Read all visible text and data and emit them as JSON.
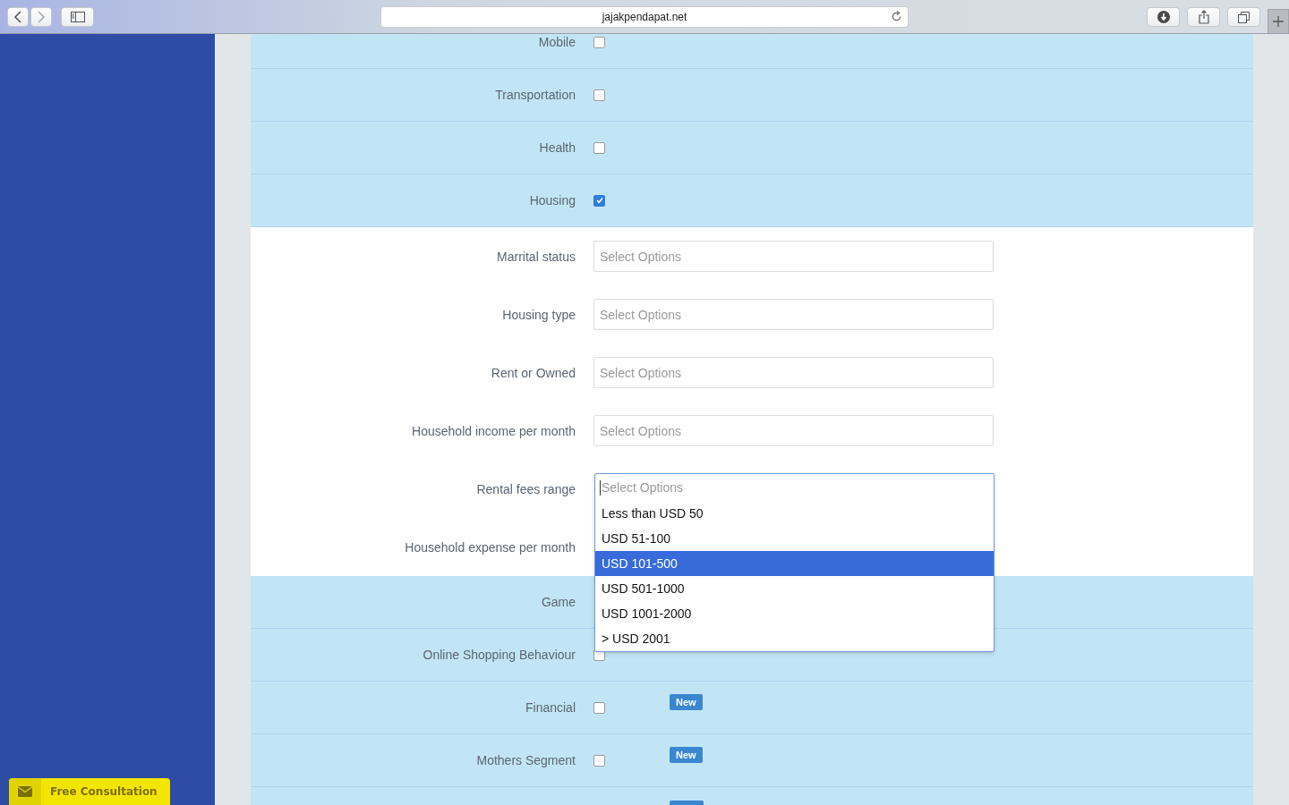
{
  "browser": {
    "url": "jajakpendapat.net"
  },
  "sections": [
    {
      "kind": "checks",
      "rows": [
        {
          "label": "Mobile",
          "checked": false
        },
        {
          "label": "Transportation",
          "checked": false
        },
        {
          "label": "Health",
          "checked": false
        },
        {
          "label": "Housing",
          "checked": true
        }
      ]
    },
    {
      "kind": "selects",
      "rows": [
        {
          "label": "Marrital status",
          "placeholder": "Select Options"
        },
        {
          "label": "Housing type",
          "placeholder": "Select Options"
        },
        {
          "label": "Rent or Owned",
          "placeholder": "Select Options"
        },
        {
          "label": "Household income per month",
          "placeholder": "Select Options"
        },
        {
          "label": "Rental fees range",
          "placeholder": "Select Options",
          "options": [
            {
              "label": "Less than USD 50",
              "selected": false
            },
            {
              "label": "USD 51-100",
              "selected": false
            },
            {
              "label": "USD 101-500",
              "selected": true
            },
            {
              "label": "USD 501-1000",
              "selected": false
            },
            {
              "label": "USD 1001-2000",
              "selected": false
            },
            {
              "label": "> USD 2001",
              "selected": false
            }
          ]
        },
        {
          "label": "Household expense per month"
        }
      ]
    },
    {
      "kind": "checks",
      "rows": [
        {
          "label": "Game"
        },
        {
          "label": "Online Shopping Behaviour",
          "checked": false
        },
        {
          "label": "Financial",
          "checked": false,
          "badge": "New"
        },
        {
          "label": "Mothers Segment",
          "checked": false,
          "badge": "New"
        },
        {
          "badge_cut": true
        }
      ]
    }
  ],
  "consultation_button": {
    "label": "Free Consultation"
  }
}
